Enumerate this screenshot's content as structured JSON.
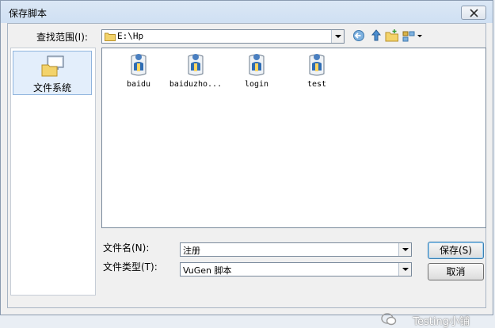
{
  "window": {
    "title": "保存脚本"
  },
  "lookin": {
    "label": "查找范围(I):",
    "value": "E:\\Hp"
  },
  "toolbar": {
    "icons": [
      "back-arrow-icon",
      "up-folder-icon",
      "new-folder-icon",
      "view-menu-icon"
    ]
  },
  "places": {
    "items": [
      {
        "label": "文件系统",
        "icon": "computer-folder-icon"
      }
    ]
  },
  "files": [
    {
      "name": "baidu",
      "icon": "script-user-icon"
    },
    {
      "name": "baiduzho...",
      "icon": "script-user-icon"
    },
    {
      "name": "login",
      "icon": "script-user-icon"
    },
    {
      "name": "test",
      "icon": "script-user-icon"
    }
  ],
  "filename": {
    "label": "文件名(N):",
    "value": "注册"
  },
  "filetype": {
    "label": "文件类型(T):",
    "value": "VuGen 脚本"
  },
  "buttons": {
    "save": "保存(S)",
    "cancel": "取消"
  },
  "watermark": {
    "text": "Testing小铺"
  }
}
